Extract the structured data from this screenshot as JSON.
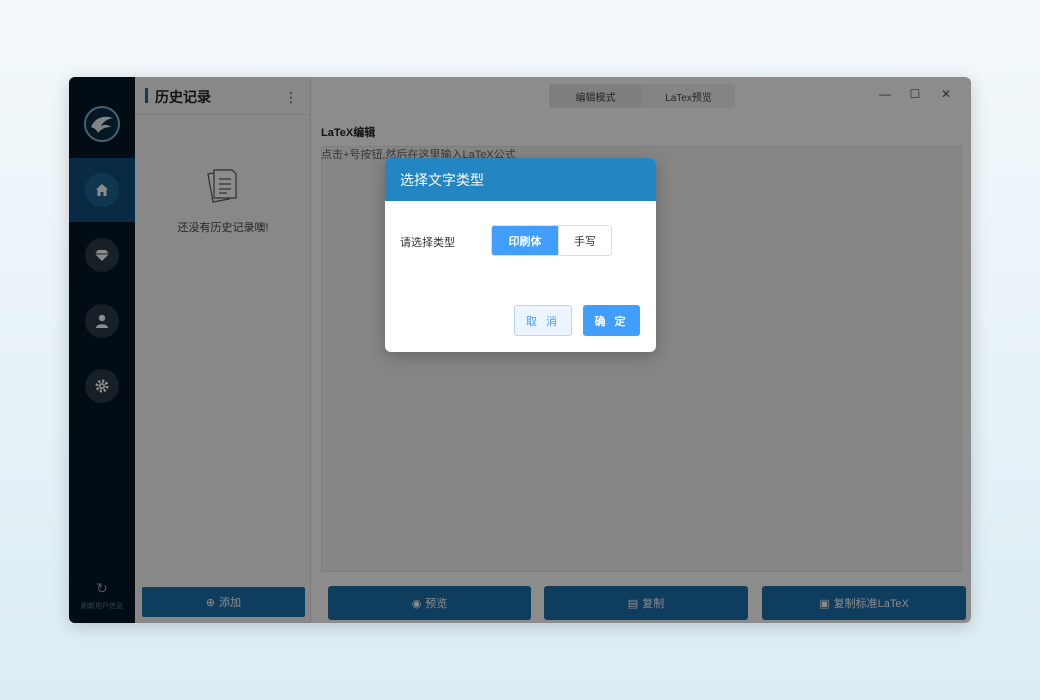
{
  "history": {
    "title": "历史记录",
    "more_icon": "more-vertical-icon",
    "empty_text": "还没有历史记录噢!",
    "add_label": "添加"
  },
  "rail": {
    "items": [
      {
        "icon": "home-icon"
      },
      {
        "icon": "diamond-icon"
      },
      {
        "icon": "user-icon"
      },
      {
        "icon": "gear-icon"
      }
    ],
    "bottom_label": "刷新用户信息"
  },
  "main": {
    "tabs": [
      {
        "label": "编辑模式"
      },
      {
        "label": "LaTex预览"
      }
    ],
    "editor_title": "LaTeX编辑",
    "editor_placeholder": "点击+号按钮,然后在这里输入LaTeX公式",
    "preview_label": "预览",
    "copy_label": "复制",
    "copy_std_label": "复制标准LaTeX"
  },
  "dialog": {
    "title": "选择文字类型",
    "prompt": "请选择类型",
    "options": [
      {
        "label": "印刷体"
      },
      {
        "label": "手写"
      }
    ],
    "selected": "印刷体",
    "cancel_label": "取 消",
    "confirm_label": "确 定"
  },
  "colors": {
    "accent": "#1d6fa9",
    "dialog_header": "#2385c2",
    "primary_button": "#409eff",
    "rail": "#041726"
  }
}
